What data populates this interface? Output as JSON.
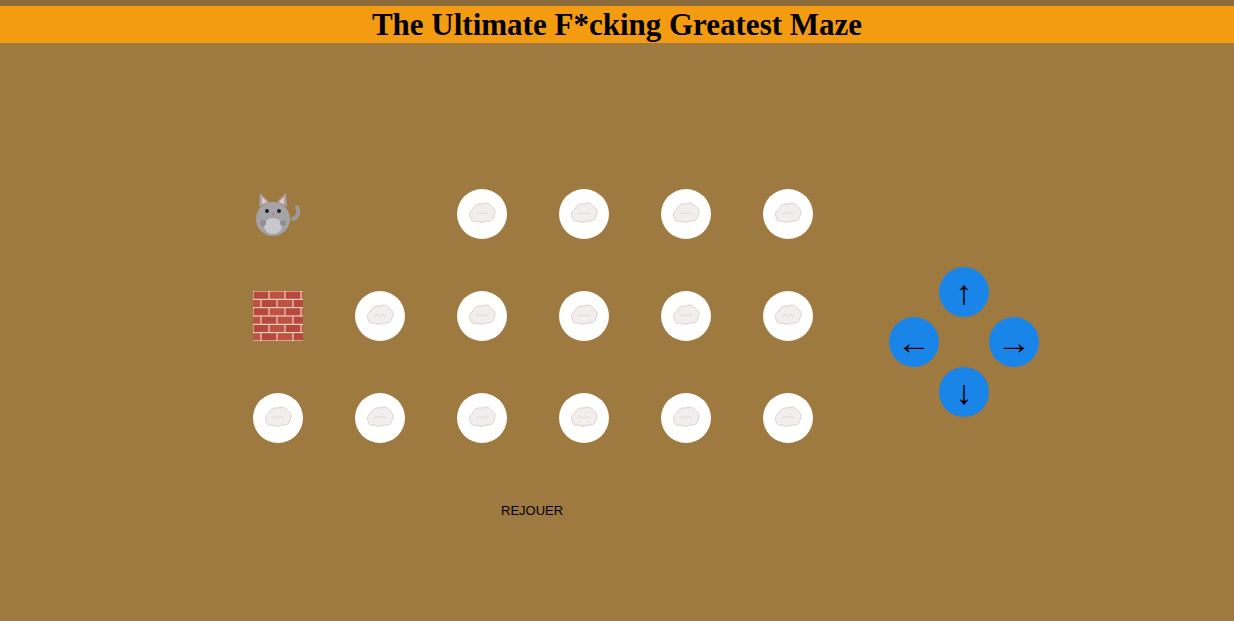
{
  "header": {
    "title": "The Ultimate F*cking Greatest Maze"
  },
  "maze": {
    "rows": [
      [
        {
          "kind": "cat"
        },
        {
          "kind": "empty"
        },
        {
          "kind": "food"
        },
        {
          "kind": "food"
        },
        {
          "kind": "food"
        },
        {
          "kind": "food"
        }
      ],
      [
        {
          "kind": "wall"
        },
        {
          "kind": "food"
        },
        {
          "kind": "food"
        },
        {
          "kind": "food"
        },
        {
          "kind": "food"
        },
        {
          "kind": "food"
        }
      ],
      [
        {
          "kind": "food"
        },
        {
          "kind": "food"
        },
        {
          "kind": "food"
        },
        {
          "kind": "food"
        },
        {
          "kind": "food"
        },
        {
          "kind": "food"
        }
      ]
    ]
  },
  "controls": {
    "up": "↑",
    "left": "←",
    "right": "→",
    "down": "↓"
  },
  "replay_button": "REJOUER"
}
